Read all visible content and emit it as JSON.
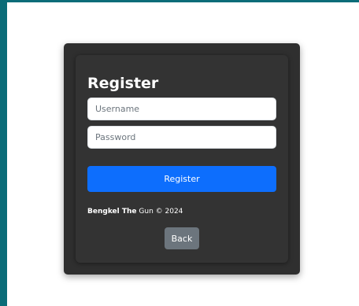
{
  "form": {
    "title": "Register",
    "username_placeholder": "Username",
    "password_placeholder": "Password",
    "register_label": "Register",
    "back_label": "Back"
  },
  "footer": {
    "brand_bold": "Bengkel The",
    "brand_rest": " Gun © 2024"
  },
  "colors": {
    "sidebar_accent": "#0b6c78",
    "card_background": "#2f2f2f",
    "primary_button": "#0d6efd",
    "secondary_button": "#6c757d"
  }
}
